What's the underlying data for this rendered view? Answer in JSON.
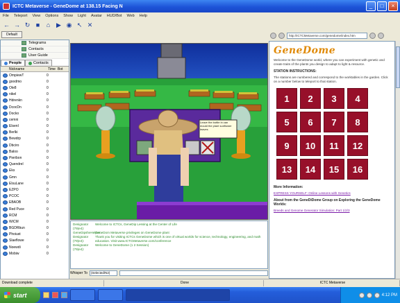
{
  "window": {
    "title": "ICTC Metaverse - GeneDome at 138.15 Facing N",
    "controls": [
      "minimize",
      "maximize",
      "close"
    ]
  },
  "menubar": [
    "File",
    "Teleport",
    "View",
    "Options",
    "Show",
    "Light",
    "Avatar",
    "HUD/Bot",
    "Web",
    "Help"
  ],
  "toolbar": {
    "icons": [
      "back-icon",
      "forward-icon",
      "refresh-icon",
      "stop-icon",
      "home-icon",
      "go-icon",
      "camera-icon",
      "pointer-icon",
      "delete-icon"
    ],
    "glyphs": [
      "←",
      "→",
      "↻",
      "■",
      "⌂",
      "▶",
      "◉",
      "↖",
      "✕"
    ],
    "default_label": "Default"
  },
  "sidebar": {
    "tools": [
      "Telegrams",
      "Contacts",
      "User Guide"
    ],
    "tabs": [
      {
        "label": "People",
        "active": true
      },
      {
        "label": "Contacts",
        "active": false
      }
    ],
    "columns": [
      "Nickname",
      "Time",
      "Bot"
    ],
    "people": [
      {
        "name": "OmpiewT",
        "time": "0"
      },
      {
        "name": "goodmo",
        "time": "0"
      },
      {
        "name": "Ole8",
        "time": "0"
      },
      {
        "name": "nikel",
        "time": "0"
      },
      {
        "name": "Hdrenkn",
        "time": "0"
      },
      {
        "name": "DcocDn",
        "time": "0"
      },
      {
        "name": "Docko",
        "time": "0"
      },
      {
        "name": "cemni",
        "time": "0"
      },
      {
        "name": "ElsenI",
        "time": "0"
      },
      {
        "name": "Berlki",
        "time": "0"
      },
      {
        "name": "Bewdrp",
        "time": "0"
      },
      {
        "name": "Dbciro",
        "time": "0"
      },
      {
        "name": "Baloo",
        "time": "0"
      },
      {
        "name": "Pieribon",
        "time": "0"
      },
      {
        "name": "Quendrel",
        "time": "0"
      },
      {
        "name": "Eks",
        "time": "0"
      },
      {
        "name": "Gmn",
        "time": "0"
      },
      {
        "name": "ElsuLane",
        "time": "0"
      },
      {
        "name": "EZPO",
        "time": "0"
      },
      {
        "name": "PCOC",
        "time": "0"
      },
      {
        "name": "EBAOB",
        "time": "0"
      },
      {
        "name": "Red Puce",
        "time": "0"
      },
      {
        "name": "RCM",
        "time": "0"
      },
      {
        "name": "WiCM",
        "time": "0"
      },
      {
        "name": "BGDRbun",
        "time": "0"
      },
      {
        "name": "Phoiust",
        "time": "0"
      },
      {
        "name": "Slaeflowe",
        "time": "0"
      },
      {
        "name": "Noewdi",
        "time": "0"
      },
      {
        "name": "Mobiw",
        "time": "0"
      }
    ]
  },
  "scene": {
    "sign_text": "Leave the bottle in can mould the plant sunflower leaves"
  },
  "chat": {
    "lines": [
      {
        "who": "Designator (79)e4):",
        "text": "Welcome to ICTCs, GeneDip Lessing at the Center of Life"
      },
      {
        "who": "GeneDipsheHelper:",
        "text": "GeneDom Metaverse privileges on GeneDome plant"
      },
      {
        "who": "Designator (79)e4):",
        "text": "Thank you for visiting ICTCs GeneDome which is one of virtual worlds for science, technology, engineering, and math education. Visit www.ICTCMetaverse.com/conference"
      },
      {
        "who": "Designator (79)e4):",
        "text": "Welcome to GeneDome (1 2 Session)"
      }
    ],
    "mode_label": "Whisper To",
    "mode_value": "(Selected/N2)"
  },
  "browser": {
    "url": "http://ICTCMetaverse.com/genedome/index.htm",
    "title": "GeneDome",
    "intro": "Welcome to the GeneDome world, where you can experiment with genetic and create traits of the plants you design to adapt to light & resource.",
    "instructions_heading": "STATION INSTRUCTIONS:",
    "instructions": "The stations are numbered and correspond to the worktables in the garden. Click on a number below to teleport to that station.",
    "stations": [
      "1",
      "2",
      "3",
      "4",
      "5",
      "6",
      "7",
      "8",
      "9",
      "10",
      "11",
      "12",
      "13",
      "14",
      "15",
      "16"
    ],
    "more_info_heading": "More Information:",
    "link1": "EXPRESS YOURSELF: Online Lessons with Genetics",
    "more_heading2": "About from the GeneDiDome Group on Exploring the GeneDome Worlds:",
    "link2": "Breeds and Genome Generator Simulation: Part 1/2/3"
  },
  "statusbar": {
    "left": "Download complete",
    "middle": "Done",
    "right": "ICTC Metaverse"
  },
  "taskbar": {
    "start_label": "start",
    "tasks": [
      {
        "label": "",
        "active": false
      },
      {
        "label": "",
        "active": false
      },
      {
        "label": "",
        "active": true
      }
    ],
    "clock": "4:12 PM"
  },
  "colors": {
    "accent_title": "#e08a08",
    "station_button": "#97102a",
    "chat_text": "#2b8a2b",
    "taskbar": "#245edb"
  }
}
